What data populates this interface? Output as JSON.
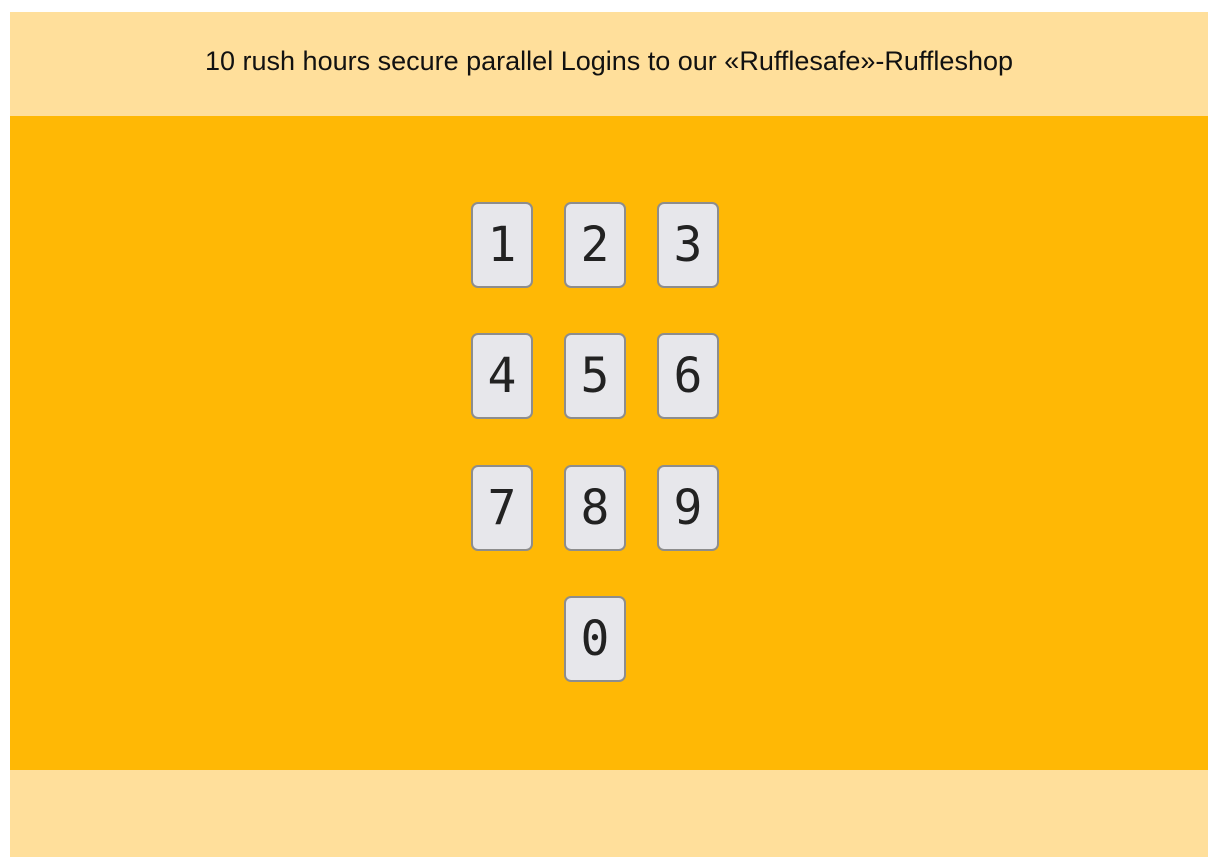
{
  "header": {
    "title": "10 rush hours secure parallel Logins to our «Rufflesafe»-Ruffleshop"
  },
  "keypad": {
    "keys": [
      "1",
      "2",
      "3",
      "4",
      "5",
      "6",
      "7",
      "8",
      "9",
      "0"
    ]
  },
  "colors": {
    "header_background": "#ffdf9b",
    "main_background": "#ffb805",
    "footer_background": "#ffdf9b",
    "key_background": "#e7e7eb",
    "key_border": "#8d8d8d"
  }
}
